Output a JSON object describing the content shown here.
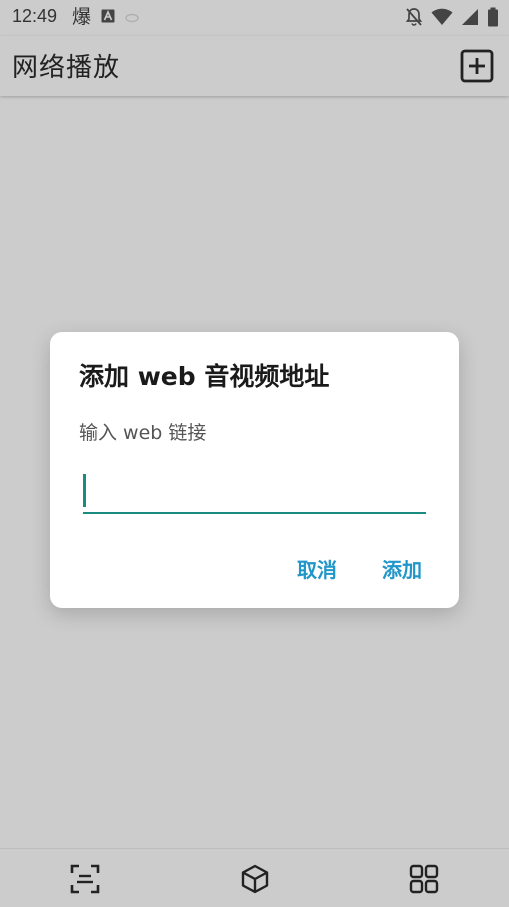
{
  "status_bar": {
    "time": "12:49",
    "notification_glyph": "爆"
  },
  "app_bar": {
    "title": "网络播放"
  },
  "dialog": {
    "title": "添加 web 音视频地址",
    "hint": "输入 web 链接",
    "input_value": "",
    "cancel_label": "取消",
    "confirm_label": "添加"
  },
  "icons": {
    "status_left": [
      "notification-explode-icon",
      "a-box-icon",
      "dot-icon"
    ],
    "status_right": [
      "bell-off-icon",
      "wifi-icon",
      "signal-icon",
      "battery-icon"
    ],
    "app_bar_action": "add-box-icon",
    "bottom_nav": [
      "scan-icon",
      "cube-icon",
      "apps-grid-icon"
    ]
  },
  "colors": {
    "background": "#cccccc",
    "accent": "#1b8a80",
    "button_text": "#2196c8",
    "dialog_bg": "#ffffff"
  }
}
